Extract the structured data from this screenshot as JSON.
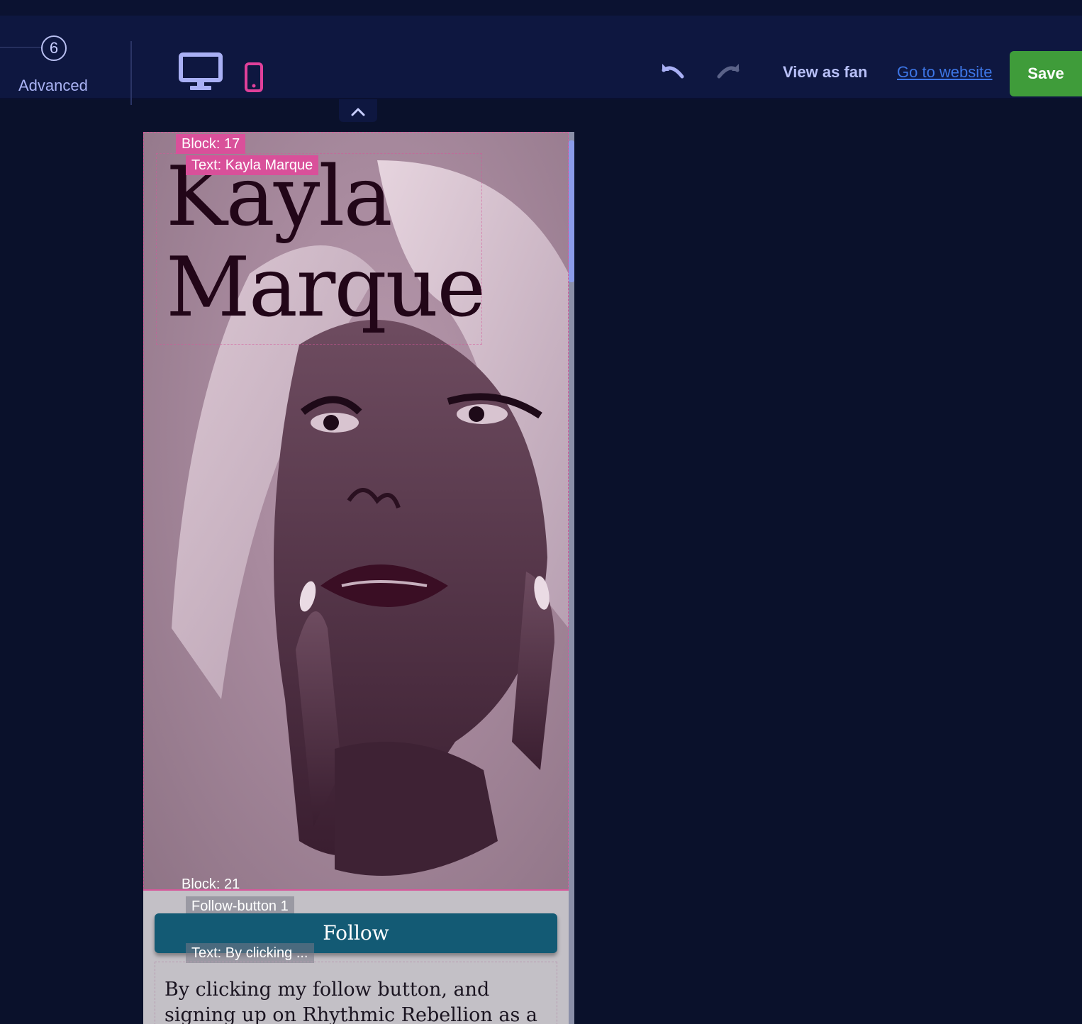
{
  "toolbar": {
    "step_number": "6",
    "step_label": "Advanced",
    "view_as_fan": "View as fan",
    "go_to_website": "Go to website",
    "save": "Save"
  },
  "icons": {
    "desktop": "desktop-icon",
    "mobile": "mobile-icon",
    "undo": "undo-icon",
    "redo": "redo-icon",
    "collapse": "chevron-up-icon"
  },
  "colors": {
    "background": "#0a112b",
    "toolbar": "#0e1740",
    "accent_pink": "#d9509a",
    "save_green": "#3f9c3a",
    "link_blue": "#3d76e6",
    "follow_button": "#135a74"
  },
  "preview": {
    "hero_block_label": "Block: 17",
    "hero_text_label": "Text: Kayla Marque",
    "artist_name_line1": "Kayla",
    "artist_name_line2": "Marque",
    "lower_block_label": "Block: 21",
    "follow_button_label": "Follow-button 1",
    "follow_button_text": "Follow",
    "body_text_label": "Text: By clicking ...",
    "body_text": "By clicking my follow button, and signing up on Rhythmic Rebellion as a fan, you are"
  }
}
